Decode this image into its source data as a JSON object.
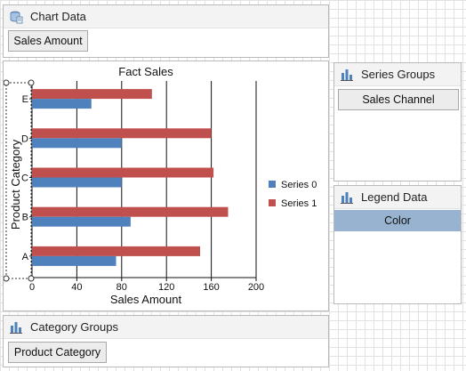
{
  "chart_data_panel": {
    "title": "Chart Data",
    "item": "Sales Amount"
  },
  "series_groups": {
    "title": "Series Groups",
    "item": "Sales Channel"
  },
  "legend_data": {
    "title": "Legend Data",
    "item": "Color"
  },
  "category_groups": {
    "title": "Category Groups",
    "item": "Product Category"
  },
  "colors": {
    "series0": "#4f81bd",
    "series1": "#c0504d",
    "legend_highlight": "#98b3cf"
  },
  "chart_data": {
    "type": "bar",
    "orientation": "horizontal",
    "title": "Fact Sales",
    "xlabel": "Sales Amount",
    "ylabel": "Product Category",
    "categories": [
      "A",
      "B",
      "C",
      "D",
      "E"
    ],
    "series": [
      {
        "name": "Series 0",
        "color": "#4f81bd",
        "values": [
          75,
          88,
          80,
          80,
          53
        ]
      },
      {
        "name": "Series 1",
        "color": "#c0504d",
        "values": [
          150,
          175,
          162,
          160,
          107
        ]
      }
    ],
    "xlim": [
      0,
      200
    ],
    "xticks": [
      "0",
      "40",
      "80",
      "120",
      "160",
      "200"
    ],
    "grid": "vertical",
    "legend_position": "right"
  }
}
